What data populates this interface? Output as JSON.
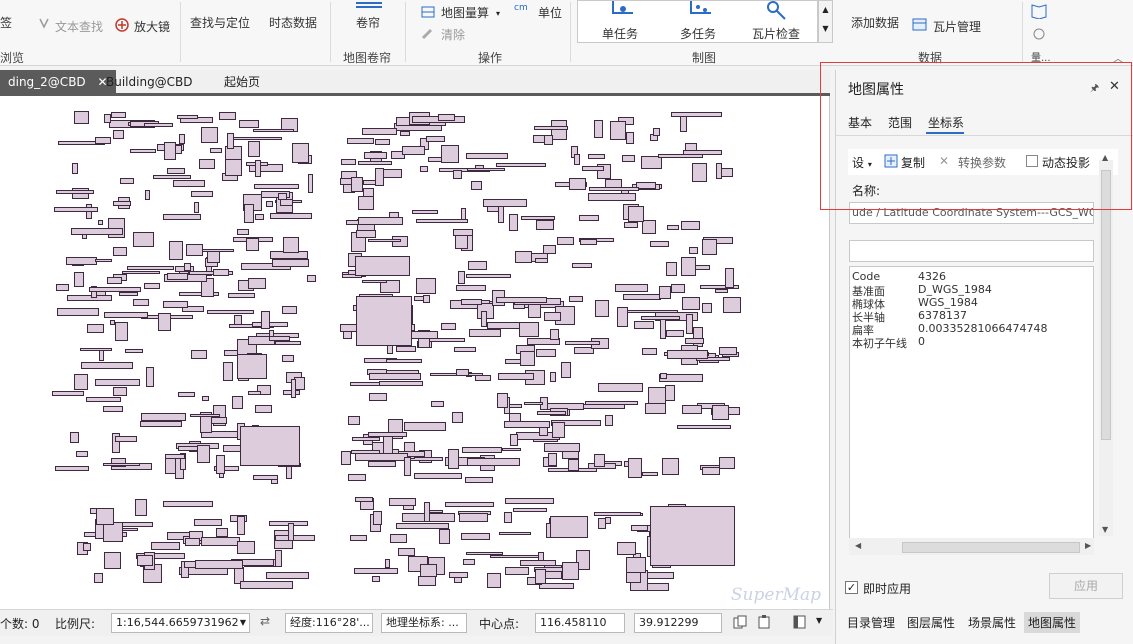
{
  "ribbon": {
    "bookmark": "签",
    "text_find": "文本查找",
    "magnifier": "放大镜",
    "find_locate": "查找与定位",
    "temporal_data": "时态数据",
    "roller_blind": "卷帘",
    "map_measure": "地图量算",
    "unit": "单位",
    "clear": "清除",
    "single_task": "单任务",
    "multi_task": "多任务",
    "tile_check": "瓦片检查",
    "add_data": "添加数据",
    "tile_manage": "瓦片管理",
    "groups": {
      "browse": "浏览",
      "map_roller": "地图卷帘",
      "operation": "操作",
      "cartography": "制图",
      "data": "数据",
      "more": "量..."
    }
  },
  "tabs": [
    {
      "label": "ding_2@CBD",
      "close": "✕"
    },
    {
      "label": "Building@CBD"
    },
    {
      "label": "起始页"
    }
  ],
  "map": {
    "watermark": "SuperMap"
  },
  "status": {
    "count_label": "个数: 0",
    "scale_label": "比例尺:",
    "scale_value": "1:16,544.6659731962",
    "coord_label": "经度:116°28'...",
    "coord_system": "地理坐标系: ...",
    "center_label": "中心点:",
    "center_x": "116.458110",
    "center_y": "39.912299"
  },
  "panel": {
    "title": "地图属性",
    "pin": "🖈",
    "close": "✕",
    "tabs": [
      "基本",
      "范围",
      "坐标系"
    ],
    "active_tab": "坐标系",
    "toolbar": {
      "preset": "设",
      "copy": "复制",
      "convert_params": "转换参数",
      "dynamic_projection": "动态投影"
    },
    "name_label": "名称:",
    "name_value": "ude / Latitude Coordinate System---GCS_WGS_",
    "info": [
      {
        "k": "Code",
        "v": "4326"
      },
      {
        "k": "基准面",
        "v": "D_WGS_1984"
      },
      {
        "k": "椭球体",
        "v": "WGS_1984"
      },
      {
        "k": "长半轴",
        "v": "6378137"
      },
      {
        "k": "扁率",
        "v": "0.00335281066474748"
      },
      {
        "k": "本初子午线",
        "v": "0"
      }
    ],
    "instant_apply": "即时应用",
    "instant_checked": "✓",
    "apply": "应用",
    "bottom_tabs": [
      "目录管理",
      "图层属性",
      "场景属性",
      "地图属性"
    ],
    "active_bottom_tab": "地图属性"
  },
  "colors": {
    "building_fill": "#dcccdc",
    "building_stroke": "#3d2a40",
    "accent_blue": "#2b6cc4",
    "highlight_red": "#e43b3b"
  }
}
